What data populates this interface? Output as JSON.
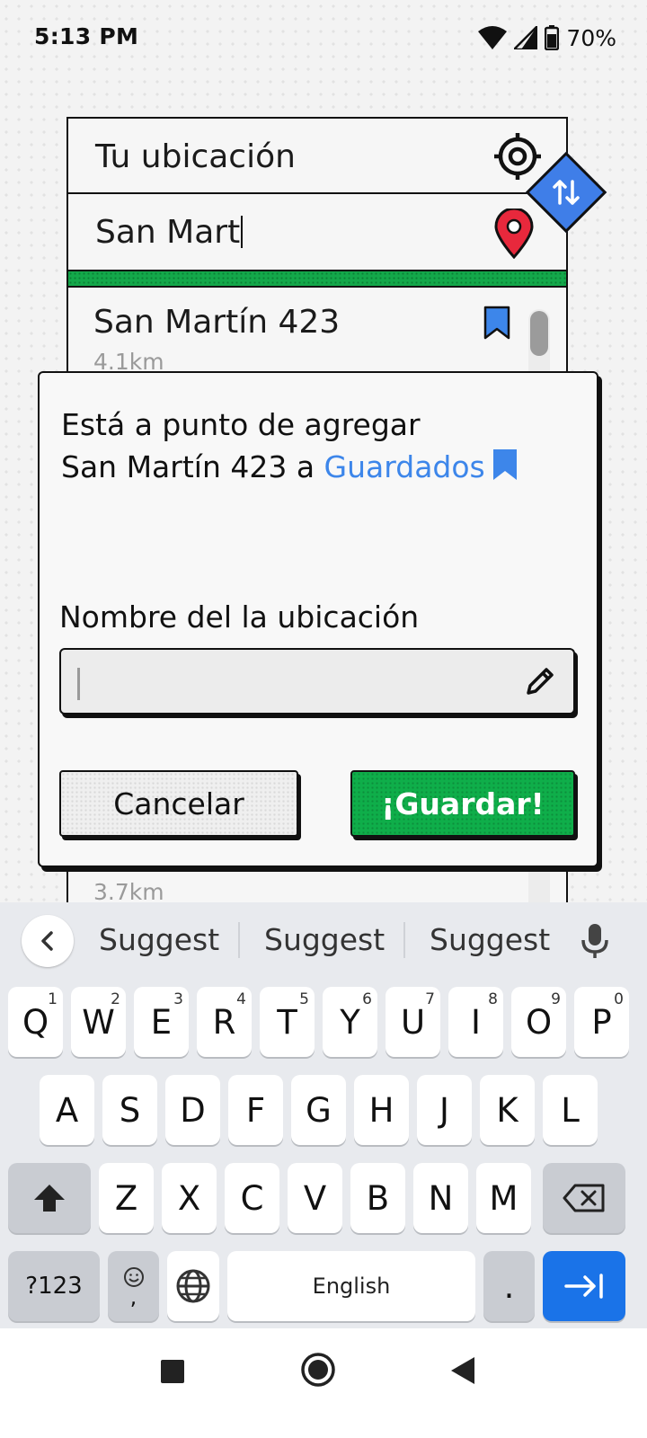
{
  "status_bar": {
    "time": "5:13 PM",
    "battery": "70%",
    "icons": [
      "wifi-icon",
      "cell-signal-icon",
      "battery-icon"
    ]
  },
  "route": {
    "origin": "Tu ubicación",
    "destination": "San Mart",
    "origin_icon": "crosshair-icon",
    "destination_icon": "map-pin-icon",
    "swap_icon": "swap-arrows-icon"
  },
  "results": [
    {
      "title": "San Martín 423",
      "distance": "4.1km"
    },
    {
      "title": "",
      "distance": "3.7km"
    }
  ],
  "dialog": {
    "message_prefix": "Está a punto de agregar",
    "place": "San Martín 423",
    "message_mid": " a ",
    "saved_link": "Guardados",
    "field_label": "Nombre del la ubicación",
    "input_value": "",
    "cancel_label": "Cancelar",
    "save_label": "¡Guardar!"
  },
  "keyboard": {
    "suggestions": [
      "Suggest",
      "Suggest",
      "Suggest"
    ],
    "row1": [
      {
        "key": "Q",
        "hint": "1"
      },
      {
        "key": "W",
        "hint": "2"
      },
      {
        "key": "E",
        "hint": "3"
      },
      {
        "key": "R",
        "hint": "4"
      },
      {
        "key": "T",
        "hint": "5"
      },
      {
        "key": "Y",
        "hint": "6"
      },
      {
        "key": "U",
        "hint": "7"
      },
      {
        "key": "I",
        "hint": "8"
      },
      {
        "key": "O",
        "hint": "9"
      },
      {
        "key": "P",
        "hint": "0"
      }
    ],
    "row2": [
      "A",
      "S",
      "D",
      "F",
      "G",
      "H",
      "J",
      "K",
      "L"
    ],
    "row3": [
      "Z",
      "X",
      "C",
      "V",
      "B",
      "N",
      "M"
    ],
    "symbols_label": "?123",
    "emoji_comma": ",",
    "space_label": "English",
    "period_label": "."
  },
  "colors": {
    "accent_blue": "#3d86ea",
    "save_green": "#0fae4a",
    "pin_red": "#e8283c",
    "keyboard_enter": "#1a73e8"
  }
}
